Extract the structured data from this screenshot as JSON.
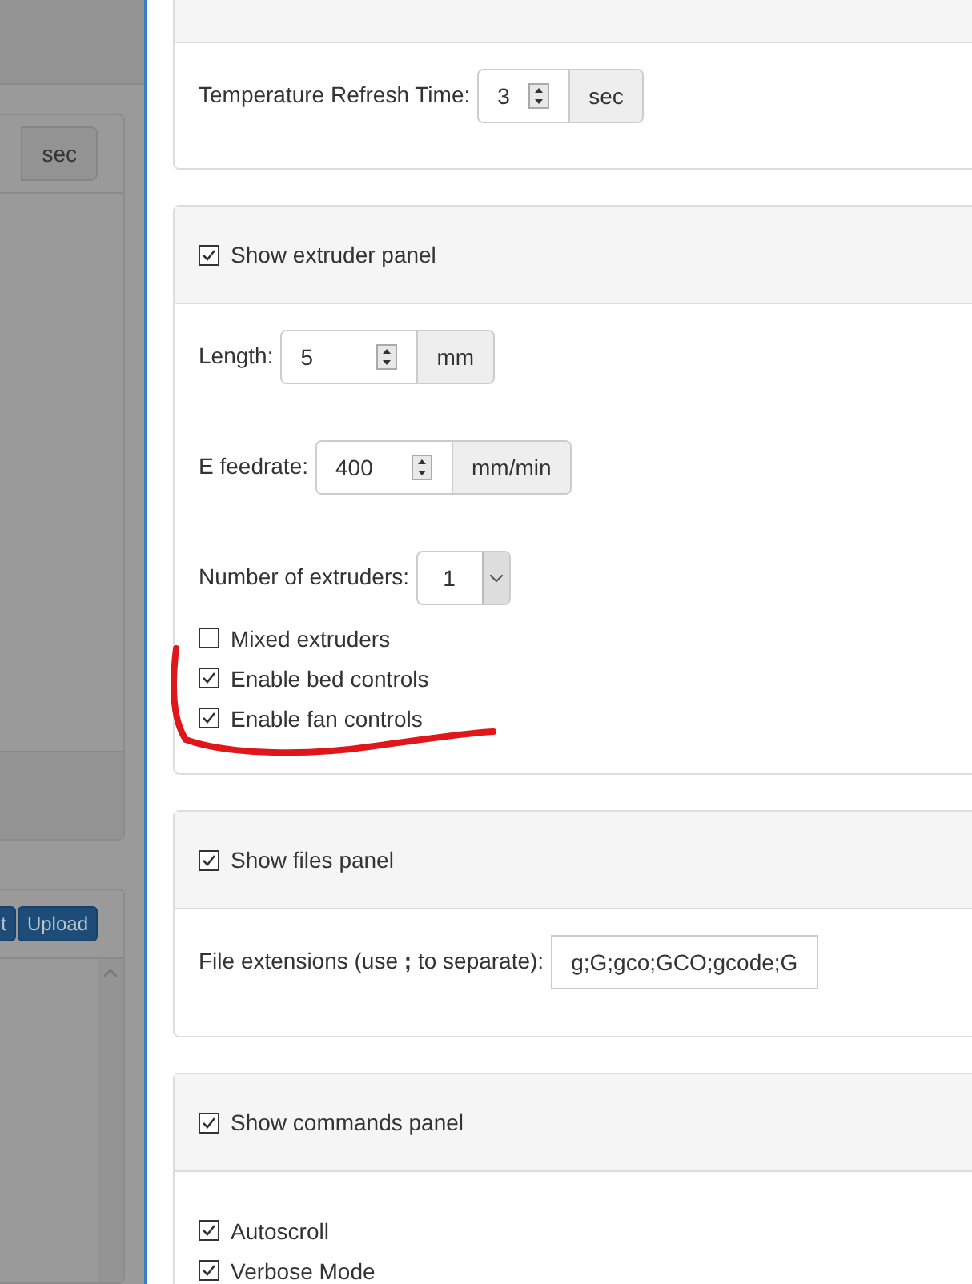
{
  "background": {
    "unit": "sec",
    "buttons": [
      "t",
      "Upload"
    ]
  },
  "top_panel": {
    "label": "Temperature Refresh Time:",
    "value": "3",
    "unit": "sec"
  },
  "panels": [
    {
      "header": {
        "label": "Show extruder panel",
        "checked": true
      },
      "items": [
        {
          "kind": "number",
          "label": "Length:",
          "value": "5",
          "unit": "mm"
        },
        {
          "kind": "number",
          "label": "E feedrate:",
          "value": "400",
          "unit": "mm/min"
        },
        {
          "kind": "select",
          "label": "Number of extruders:",
          "value": "1"
        },
        {
          "kind": "checkbox",
          "label": "Mixed extruders",
          "checked": false
        },
        {
          "kind": "checkbox",
          "label": "Enable bed controls",
          "checked": true
        },
        {
          "kind": "checkbox",
          "label": "Enable fan controls",
          "checked": true
        }
      ]
    },
    {
      "header": {
        "label": "Show files panel",
        "checked": true
      },
      "items": [
        {
          "kind": "text",
          "label": "File extensions (use **;** to separate):",
          "value": "g;G;gco;GCO;gcode;G"
        }
      ]
    },
    {
      "header": {
        "label": "Show commands panel",
        "checked": true
      },
      "items": [
        {
          "kind": "checkbox",
          "label": "Autoscroll",
          "checked": true
        },
        {
          "kind": "checkbox",
          "label": "Verbose Mode",
          "checked": true
        }
      ]
    }
  ]
}
